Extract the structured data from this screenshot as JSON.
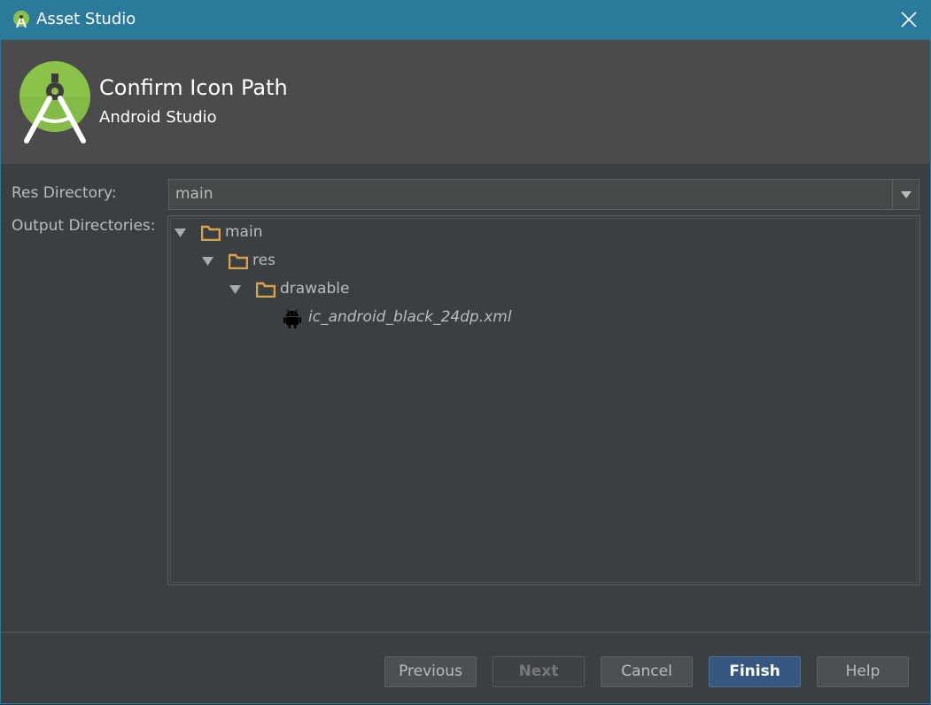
{
  "window": {
    "title": "Asset Studio"
  },
  "header": {
    "heading": "Confirm Icon Path",
    "subheading": "Android Studio"
  },
  "form": {
    "res_directory_label": "Res Directory:",
    "res_directory_value": "main",
    "output_directories_label": "Output Directories:"
  },
  "tree": {
    "nodes": [
      {
        "label": "main",
        "type": "folder",
        "expanded": true
      },
      {
        "label": "res",
        "type": "folder",
        "expanded": true
      },
      {
        "label": "drawable",
        "type": "folder",
        "expanded": true
      },
      {
        "label": "ic_android_black_24dp.xml",
        "type": "file"
      }
    ]
  },
  "buttons": {
    "previous": "Previous",
    "next": "Next",
    "cancel": "Cancel",
    "finish": "Finish",
    "help": "Help"
  },
  "colors": {
    "titlebar": "#2b7a9b",
    "background": "#3c3f41",
    "header": "#4b4b4b",
    "folder": "#d7a34b",
    "primary_button": "#365880",
    "android_logo": "#8bc34a"
  },
  "icons": {
    "app": "android-studio-icon",
    "close": "close-icon",
    "logo": "android-studio-logo",
    "folder": "folder-icon",
    "file": "android-icon",
    "expand": "triangle-down-icon",
    "dropdown": "chevron-down-icon"
  }
}
